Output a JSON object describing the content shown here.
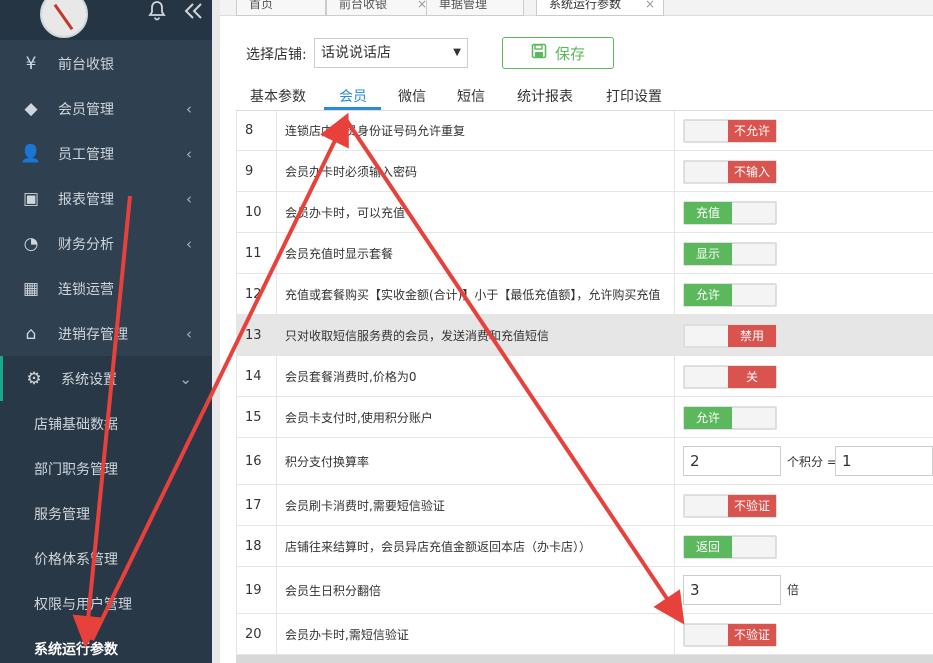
{
  "sidebar": {
    "top_icons": {
      "bell": "bell-icon",
      "collapse": "double-chevron-left-icon"
    },
    "items": [
      {
        "label": "前台收银",
        "icon": "yen-icon",
        "glyph": "¥",
        "chevron": false
      },
      {
        "label": "会员管理",
        "icon": "diamond-icon",
        "glyph": "◆",
        "chevron": true
      },
      {
        "label": "员工管理",
        "icon": "user-icon",
        "glyph": "👤",
        "chevron": true
      },
      {
        "label": "报表管理",
        "icon": "monitor-icon",
        "glyph": "▣",
        "chevron": true
      },
      {
        "label": "财务分析",
        "icon": "pie-chart-icon",
        "glyph": "◔",
        "chevron": true
      },
      {
        "label": "连锁运营",
        "icon": "building-icon",
        "glyph": "▦",
        "chevron": false
      },
      {
        "label": "进销存管理",
        "icon": "home-icon",
        "glyph": "⌂",
        "chevron": true
      },
      {
        "label": "系统设置",
        "icon": "gear-icon",
        "glyph": "⚙",
        "chevron": true
      }
    ],
    "sub_items": [
      {
        "label": "店铺基础数据"
      },
      {
        "label": "部门职务管理"
      },
      {
        "label": "服务管理"
      },
      {
        "label": "价格体系管理"
      },
      {
        "label": "权限与用户管理"
      },
      {
        "label": "系统运行参数"
      }
    ]
  },
  "tabs": [
    {
      "label": "首页"
    },
    {
      "label": "前台收银"
    },
    {
      "label": "单据管理"
    },
    {
      "label": "系统运行参数"
    }
  ],
  "store": {
    "label": "选择店铺:",
    "value": "话说说话店"
  },
  "save_label": "保存",
  "subtabs": [
    {
      "label": "基本参数"
    },
    {
      "label": "会员"
    },
    {
      "label": "微信"
    },
    {
      "label": "短信"
    },
    {
      "label": "统计报表"
    },
    {
      "label": "打印设置"
    }
  ],
  "rows": [
    {
      "num": "8",
      "desc": "连锁店内会员身份证号码允许重复",
      "type": "toggle",
      "state": "off",
      "label": "不允许"
    },
    {
      "num": "9",
      "desc": "会员办卡时必须输入密码",
      "type": "toggle",
      "state": "off",
      "label": "不输入"
    },
    {
      "num": "10",
      "desc": "会员办卡时，可以充值",
      "type": "toggle",
      "state": "on",
      "label": "充值"
    },
    {
      "num": "11",
      "desc": "会员充值时显示套餐",
      "type": "toggle",
      "state": "on",
      "label": "显示"
    },
    {
      "num": "12",
      "desc": "充值或套餐购买【实收金额(合计)】小于【最低充值额】，允许购买充值",
      "type": "toggle",
      "state": "on",
      "label": "允许"
    },
    {
      "num": "13",
      "desc": "只对收取短信服务费的会员，发送消费和充值短信",
      "type": "toggle",
      "state": "off",
      "label": "禁用"
    },
    {
      "num": "14",
      "desc": "会员套餐消费时,价格为0",
      "type": "toggle",
      "state": "off",
      "label": "关"
    },
    {
      "num": "15",
      "desc": "会员卡支付时,使用积分账户",
      "type": "toggle",
      "state": "on",
      "label": "允许"
    },
    {
      "num": "16",
      "desc": "积分支付换算率",
      "type": "ratio",
      "a": "2",
      "mid": "个积分 =",
      "b": "1"
    },
    {
      "num": "17",
      "desc": "会员刷卡消费时,需要短信验证",
      "type": "toggle",
      "state": "off",
      "label": "不验证"
    },
    {
      "num": "18",
      "desc": "店铺往来结算时，会员异店充值金额返回本店（办卡店））",
      "type": "toggle",
      "state": "on",
      "label": "返回"
    },
    {
      "num": "19",
      "desc": "会员生日积分翻倍",
      "type": "input",
      "a": "3",
      "unit": "倍"
    },
    {
      "num": "20",
      "desc": "会员办卡时,需短信验证",
      "type": "toggle",
      "state": "off",
      "label": "不验证"
    }
  ],
  "colors": {
    "off": "#d9534f",
    "on": "#5cb85c",
    "accent": "#2a8bd8",
    "arrow": "#e8413c"
  }
}
